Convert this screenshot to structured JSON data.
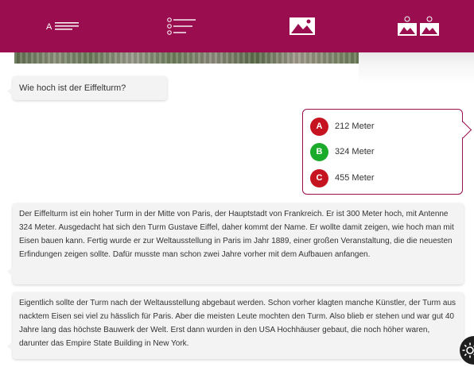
{
  "colors": {
    "brand": "#9a0e4f",
    "answer_a": "#c5141f",
    "answer_b": "#1aab2a",
    "answer_c": "#c5141f"
  },
  "toolbar": {
    "items": [
      {
        "icon": "text-lines-icon",
        "label": "A"
      },
      {
        "icon": "list-icon"
      },
      {
        "icon": "image-icon"
      },
      {
        "icon": "image-quiz-icon"
      }
    ]
  },
  "question": "Wie hoch ist der Eiffelturm?",
  "answers": [
    {
      "letter": "A",
      "text": "212 Meter"
    },
    {
      "letter": "B",
      "text": "324 Meter"
    },
    {
      "letter": "C",
      "text": "455 Meter"
    }
  ],
  "paragraphs": [
    "Der Eiffelturm ist ein hoher Turm in der Mitte von Paris, der Hauptstadt von Frankreich. Er ist 300 Meter hoch, mit Antenne 324 Meter. Ausgedacht hat sich den Turm Gustave Eiffel, daher kommt der Name. Er wollte damit zeigen, wie hoch man mit Eisen bauen kann. Fertig wurde er zur Weltausstellung in Paris im Jahr 1889, einer großen Veranstaltung, die die neuesten Erfindungen zeigen sollte. Dafür musste man schon zwei Jahre vorher mit dem Aufbauen anfangen.",
    "Eigentlich sollte der Turm nach der Weltausstellung abgebaut werden. Schon vorher klagten manche Künstler, der Turm aus nacktem Eisen sei viel zu hässlich für Paris. Aber die meisten Leute mochten den Turm. Also blieb er stehen und war gut 40 Jahre lang das höchste Bauwerk der Welt. Erst dann wurden in den USA Hochhäuser gebaut, die noch höher waren, darunter das Empire State Building in New York."
  ],
  "settings_icon": "gear-icon"
}
